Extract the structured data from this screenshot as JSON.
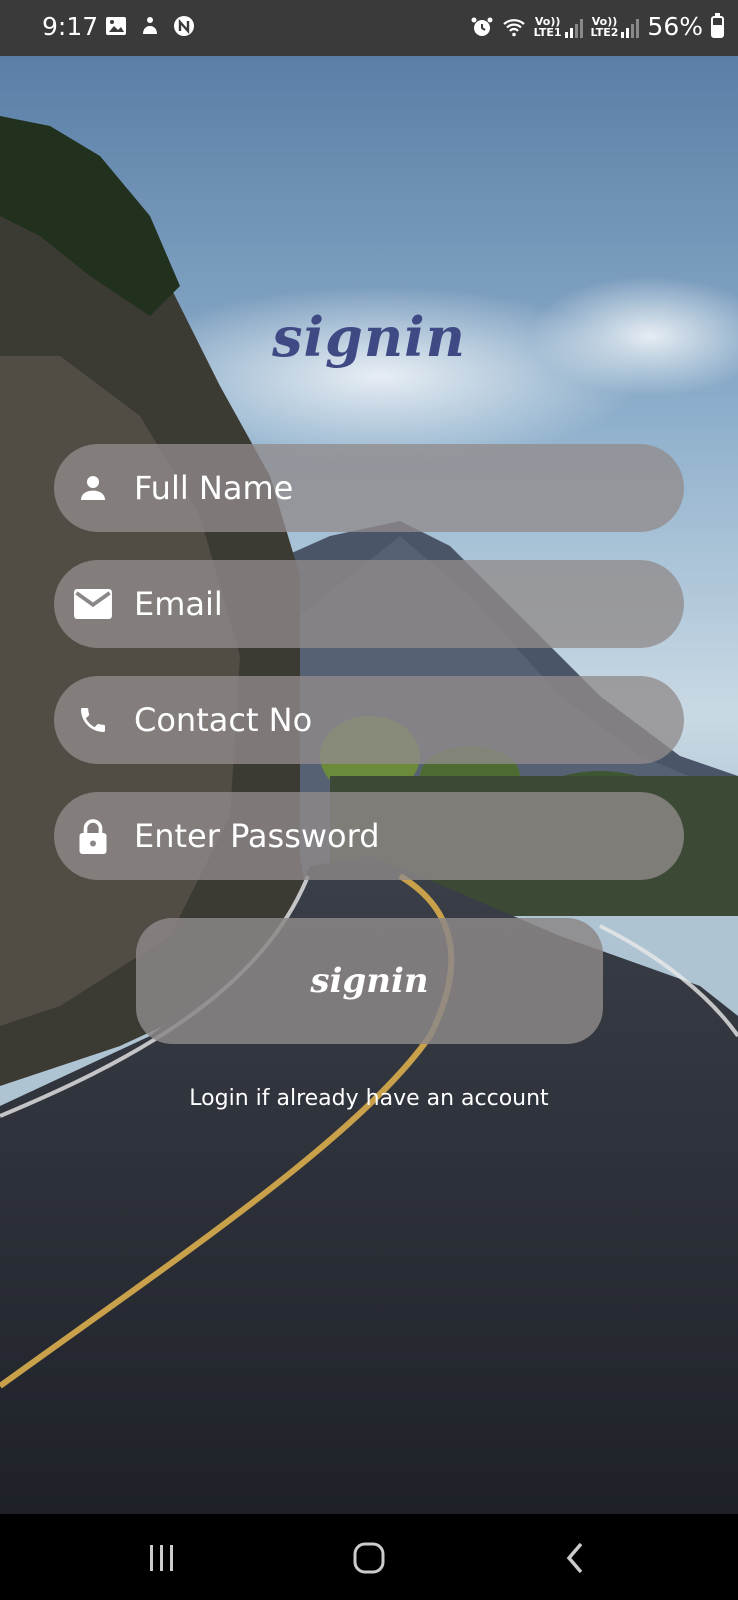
{
  "status_bar": {
    "time": "9:17",
    "sim1_label_top": "Vo))",
    "sim1_label_bottom": "LTE1",
    "sim2_label_top": "Vo))",
    "sim2_label_bottom": "LTE2",
    "battery_text": "56%",
    "battery_level": 0.56
  },
  "form": {
    "title": "signin",
    "full_name_placeholder": "Full Name",
    "email_placeholder": "Email",
    "contact_placeholder": "Contact No",
    "password_placeholder": "Enter Password",
    "submit_label": "signin",
    "login_link": "Login if already have an account"
  },
  "icons": {
    "full_name": "person-icon",
    "email": "mail-icon",
    "contact": "phone-icon",
    "password": "lock-icon"
  }
}
